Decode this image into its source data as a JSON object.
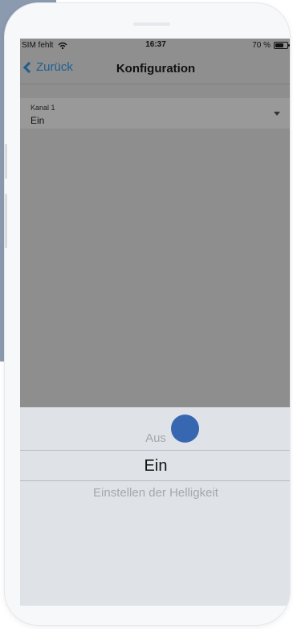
{
  "status_bar": {
    "carrier": "SIM fehlt",
    "wifi_icon": "wifi-icon",
    "time": "16:37",
    "battery_percent": "70 %",
    "battery_level": 0.7
  },
  "navbar": {
    "back_label": "Zurück",
    "title": "Konfiguration"
  },
  "channel": {
    "label": "Kanal 1",
    "value": "Ein"
  },
  "picker": {
    "options": [
      {
        "label": "Aus"
      },
      {
        "label": "Ein"
      },
      {
        "label": "Einstellen der Helligkeit"
      }
    ],
    "selected": "Ein"
  },
  "colors": {
    "accent": "#1f5f8f",
    "touch_indicator": "#3867b2",
    "overlay_gray": "#8f8f8f",
    "picker_bg": "#dfe3e8"
  }
}
